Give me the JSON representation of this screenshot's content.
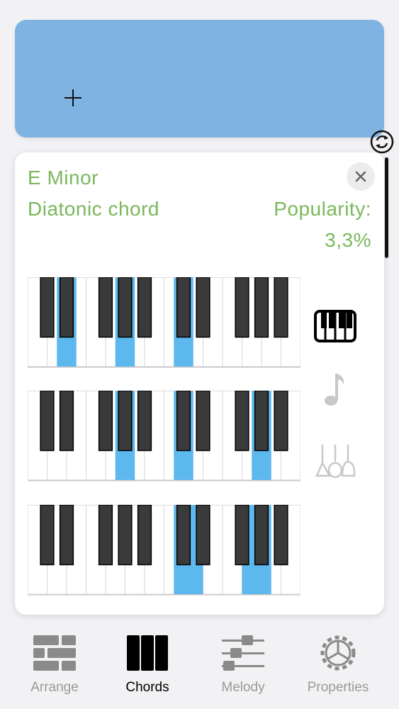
{
  "chord": {
    "name": "E Minor",
    "type_label": "Diatonic chord",
    "popularity_label": "Popularity:",
    "popularity_value": "3,3%",
    "popularity_percent": 3.3
  },
  "keyboards": [
    {
      "highlighted_white": [],
      "highlighted_black": [
        1,
        3,
        5
      ]
    },
    {
      "highlighted_white": [],
      "highlighted_black": [
        3,
        5,
        8
      ]
    },
    {
      "highlighted_white": [
        8,
        11
      ],
      "highlighted_black": [
        5,
        8,
        10
      ]
    }
  ],
  "side_icons": [
    "piano-icon",
    "music-note-icon",
    "instruments-icon"
  ],
  "tabs": [
    {
      "label": "Arrange",
      "icon": "bricks-icon",
      "active": false
    },
    {
      "label": "Chords",
      "icon": "chords-icon",
      "active": true
    },
    {
      "label": "Melody",
      "icon": "sliders-icon",
      "active": false
    },
    {
      "label": "Properties",
      "icon": "gear-icon",
      "active": false
    }
  ],
  "colors": {
    "slot": "#7fb3e1",
    "accent_text": "#7ab85c",
    "highlight": "#5db8ee",
    "inactive": "#9a9a9a"
  }
}
